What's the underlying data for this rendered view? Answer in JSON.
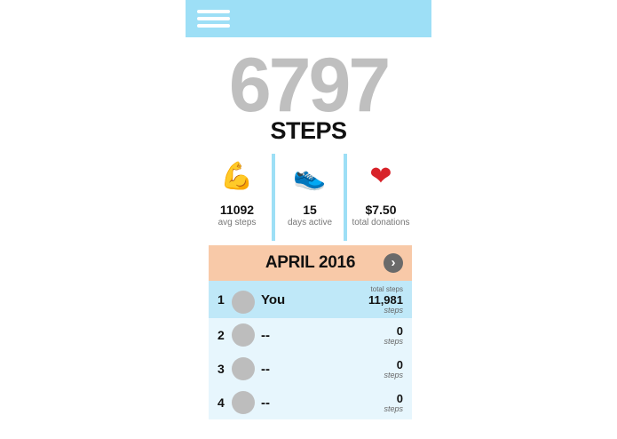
{
  "header": {
    "menu_icon": "hamburger-menu-icon",
    "color": "#9ddff6"
  },
  "summary": {
    "count": "6797",
    "label": "STEPS"
  },
  "stats": [
    {
      "icon": "flexed-biceps-icon",
      "emoji": "💪",
      "value": "11092",
      "caption": "avg steps"
    },
    {
      "icon": "sneaker-icon",
      "emoji": "👟",
      "value": "15",
      "caption": "days active"
    },
    {
      "icon": "red-heart-icon",
      "emoji": "❤",
      "value": "$7.50",
      "caption": "total donations"
    }
  ],
  "leaderboard": {
    "month": "APRIL 2016",
    "next_icon": "chevron-right-icon",
    "next_glyph": "›",
    "rows": [
      {
        "rank": "1",
        "name": "You",
        "header": "total steps",
        "steps": "11,981",
        "unit": "steps"
      },
      {
        "rank": "2",
        "name": "--",
        "steps": "0",
        "unit": "steps"
      },
      {
        "rank": "3",
        "name": "--",
        "steps": "0",
        "unit": "steps"
      },
      {
        "rank": "4",
        "name": "--",
        "steps": "0",
        "unit": "steps"
      }
    ]
  },
  "colors": {
    "accent": "#9ddff6",
    "month_header": "#f8c9a8",
    "row_self": "#bfe8f8",
    "row": "#e7f6fd",
    "big_number": "#bfbfbf"
  }
}
